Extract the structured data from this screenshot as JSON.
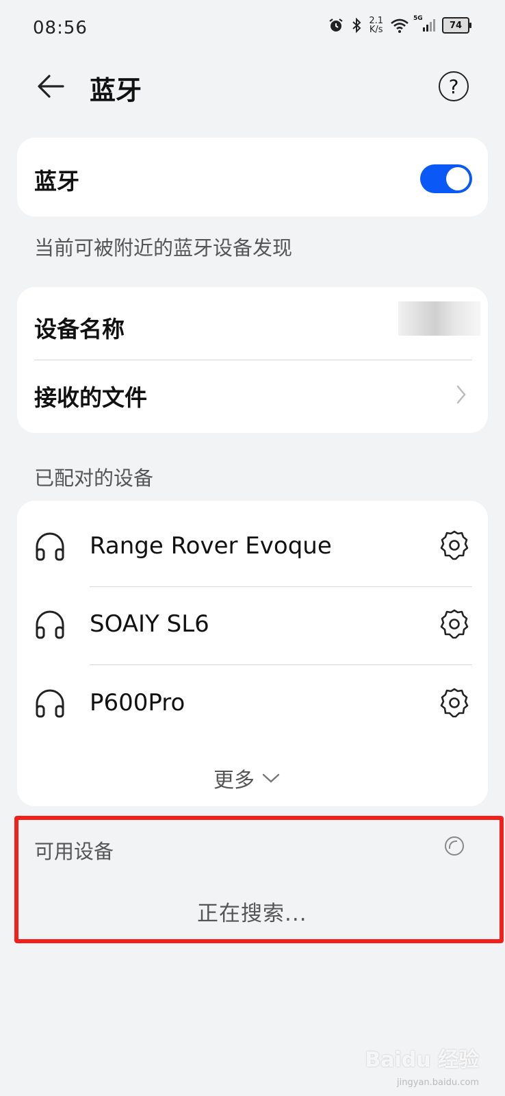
{
  "status_bar": {
    "time": "08:56",
    "net_speed_value": "2.1",
    "net_speed_unit": "K/s",
    "network_type": "5G",
    "battery": "74"
  },
  "header": {
    "title": "蓝牙",
    "help_symbol": "?"
  },
  "bluetooth_card": {
    "label": "蓝牙",
    "toggle_on": true,
    "accent_color": "#0a59f7"
  },
  "visibility_note": "当前可被附近的蓝牙设备发现",
  "settings_card": {
    "device_name_label": "设备名称",
    "received_files_label": "接收的文件"
  },
  "paired_section": {
    "title": "已配对的设备",
    "devices": [
      {
        "name": "Range Rover Evoque",
        "icon": "headphones-icon"
      },
      {
        "name": "SOAIY SL6",
        "icon": "headphones-icon"
      },
      {
        "name": "P600Pro",
        "icon": "headphones-icon"
      }
    ],
    "more_label": "更多"
  },
  "available_section": {
    "title": "可用设备",
    "status": "正在搜索..."
  },
  "watermark": {
    "text": "Baidu 经验",
    "sub": "jingyan.baidu.com"
  }
}
